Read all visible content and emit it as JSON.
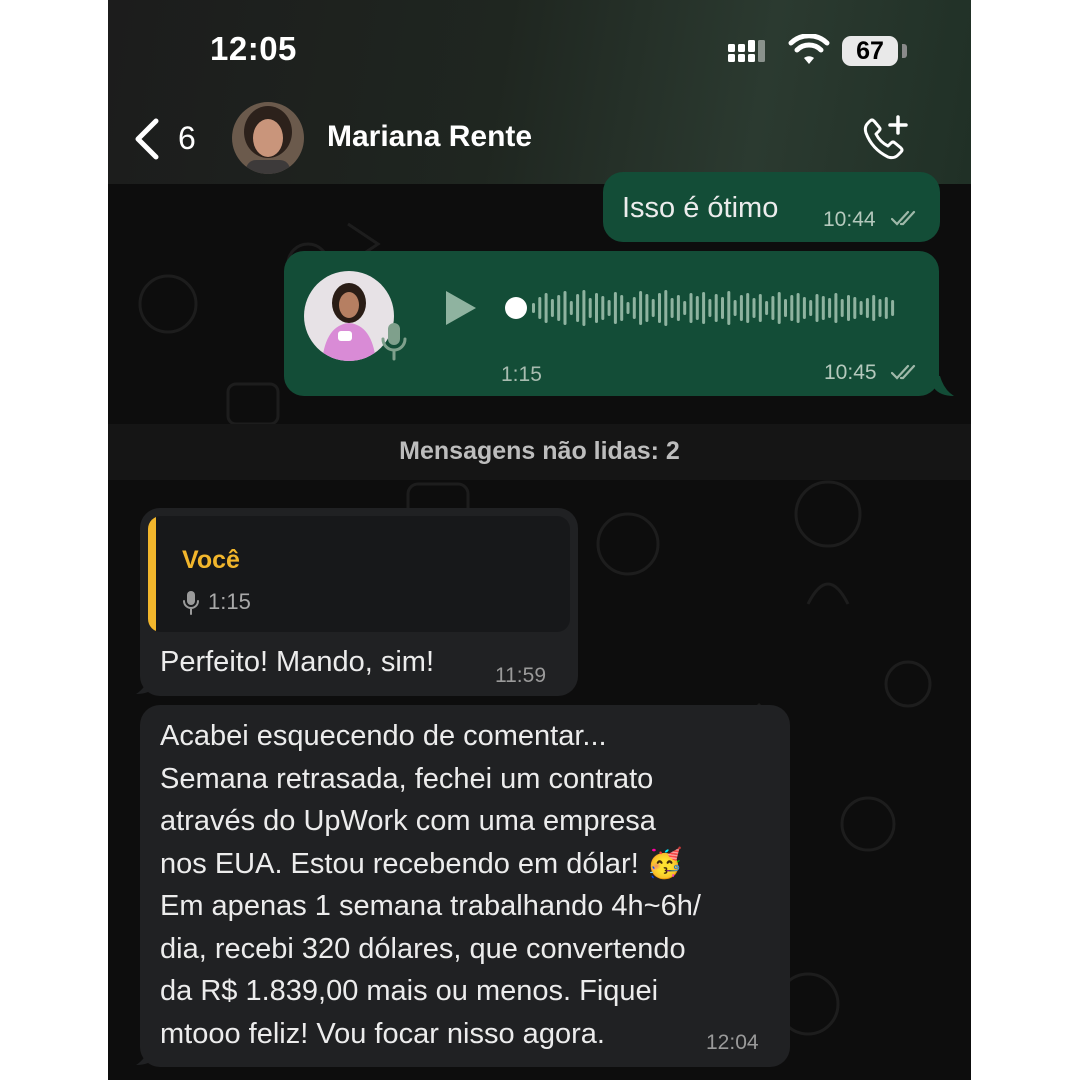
{
  "status_bar": {
    "time": "12:05",
    "battery": "67"
  },
  "header": {
    "unread_count": "6",
    "contact_name": "Mariana Rente"
  },
  "messages": {
    "out1": {
      "text": "Isso é ótimo",
      "time": "10:44"
    },
    "voice": {
      "duration": "1:15",
      "time": "10:45"
    },
    "unread_divider": "Mensagens não lidas: 2",
    "reply": {
      "quoted_author": "Você",
      "quoted_duration": "1:15",
      "text": "Perfeito! Mando, sim!",
      "time": "11:59"
    },
    "long": {
      "text": "Acabei esquecendo de comentar...\nSemana retrasada, fechei um contrato\natravés do UpWork com uma empresa\nnos EUA. Estou recebendo em dólar! 🥳\nEm apenas 1 semana trabalhando 4h~6h/\ndia, recebi 320 dólares, que convertendo\nda R$ 1.839,00 mais ou menos. Fiquei\nmtooo feliz! Vou focar nisso agora.",
      "time": "12:04"
    }
  },
  "colors": {
    "outgoing_bubble": "#134d37",
    "incoming_bubble": "#202123",
    "quote_accent": "#f2b62c"
  },
  "icons": [
    "back-chevron-icon",
    "contact-avatar",
    "add-call-icon",
    "play-icon",
    "microphone-icon",
    "read-ticks-icon",
    "signal-icon",
    "wifi-icon",
    "battery-icon"
  ]
}
